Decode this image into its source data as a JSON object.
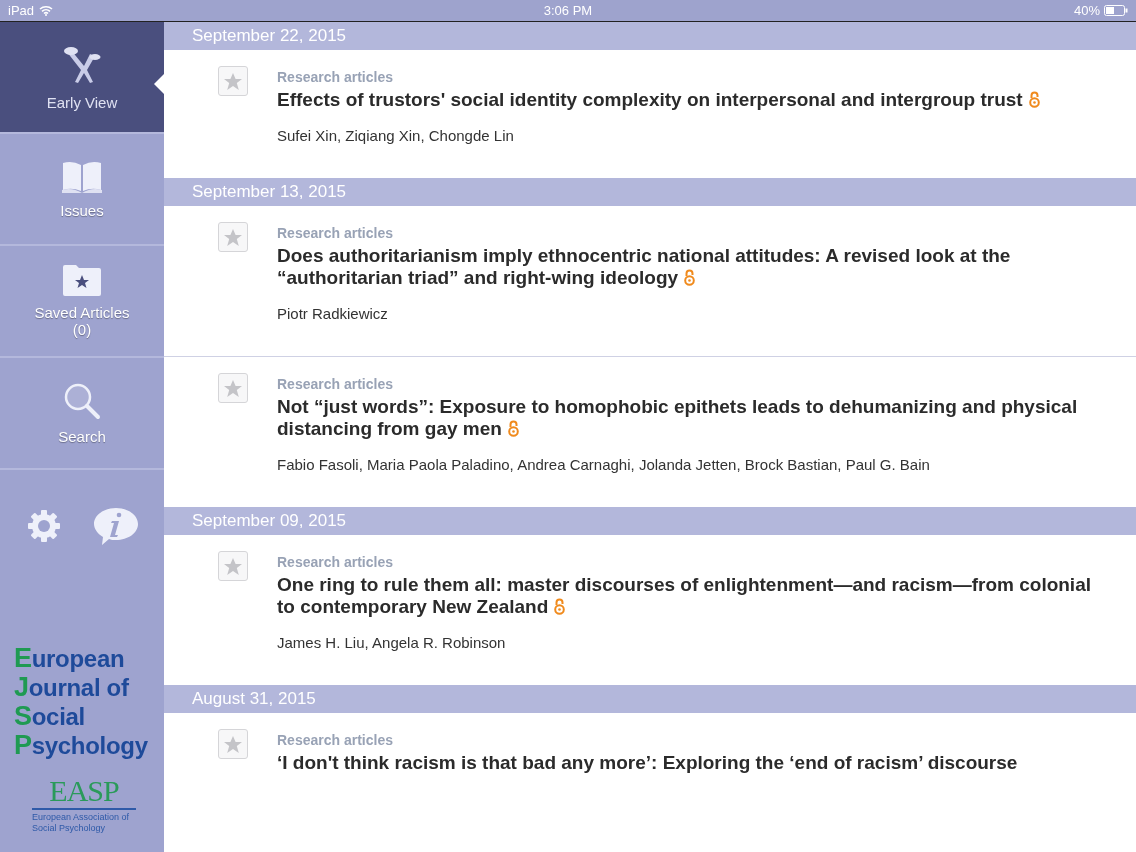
{
  "status_bar": {
    "device": "iPad",
    "time": "3:06 PM",
    "battery": "40%"
  },
  "sidebar": {
    "items": [
      {
        "kind": "early_view",
        "label": "Early View",
        "selected": true
      },
      {
        "kind": "issues",
        "label": "Issues",
        "selected": false
      },
      {
        "kind": "saved",
        "label": "Saved Articles",
        "count": "(0)",
        "selected": false
      },
      {
        "kind": "search",
        "label": "Search",
        "selected": false
      }
    ],
    "journal_logo": [
      "European",
      "Journal of",
      "Social",
      "Psychology"
    ],
    "society_logo": {
      "mark": "EASP",
      "name": "European Association of Social Psychology"
    }
  },
  "groups": [
    {
      "date": "September 22, 2015",
      "articles": [
        {
          "category": "Research articles",
          "title": "Effects of trustors' social identity complexity on interpersonal and intergroup trust",
          "open_access": true,
          "saved": false,
          "authors": "Sufei Xin, Ziqiang Xin, Chongde Lin"
        }
      ]
    },
    {
      "date": "September 13, 2015",
      "articles": [
        {
          "category": "Research articles",
          "title": "Does authoritarianism imply ethnocentric national attitudes: A revised look at the “authoritarian triad” and right-wing ideology",
          "open_access": true,
          "saved": false,
          "authors": "Piotr Radkiewicz"
        },
        {
          "category": "Research articles",
          "title": "Not “just words”: Exposure to homophobic epithets leads to dehumanizing and physical distancing from gay men",
          "open_access": true,
          "saved": false,
          "authors": "Fabio Fasoli, Maria Paola Paladino, Andrea Carnaghi, Jolanda Jetten, Brock Bastian, Paul G. Bain"
        }
      ]
    },
    {
      "date": "September 09, 2015",
      "articles": [
        {
          "category": "Research articles",
          "title": "One ring to rule them all: master discourses of enlightenment—and racism—from colonial to contemporary New Zealand",
          "open_access": true,
          "saved": false,
          "authors": "James H. Liu, Angela R. Robinson"
        }
      ]
    },
    {
      "date": "August 31, 2015",
      "articles": [
        {
          "category": "Research articles",
          "title": "‘I don't think racism is that bad any more’: Exploring the ‘end of racism’ discourse",
          "saved": false
        }
      ]
    }
  ]
}
